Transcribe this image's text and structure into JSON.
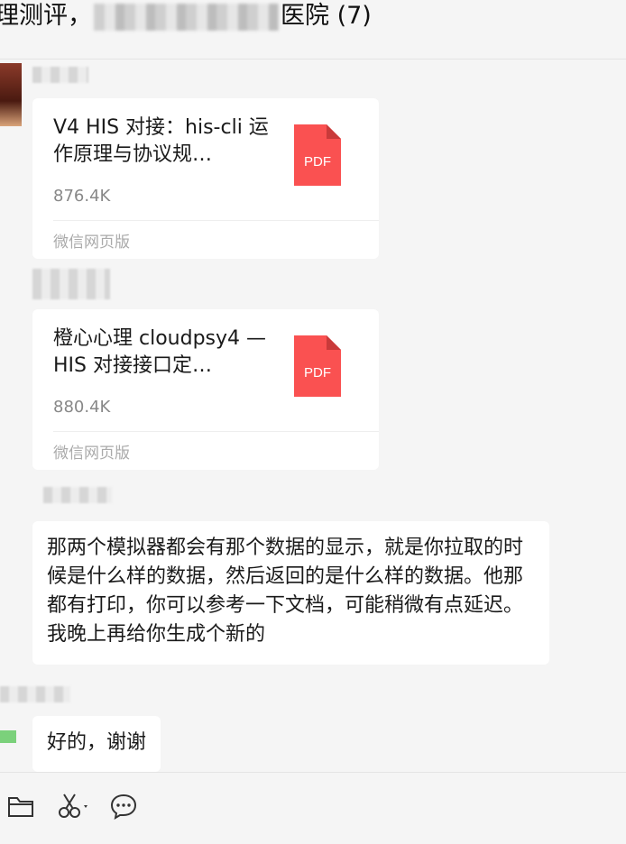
{
  "header": {
    "title_prefix": "理测评，",
    "title_suffix": "医院 (7)"
  },
  "messages": [
    {
      "type": "file",
      "file_name": "V4 HIS 对接：his-cli 运作原理与协议规…",
      "file_size": "876.4K",
      "source": "微信网页版",
      "icon_label": "PDF"
    },
    {
      "type": "file",
      "file_name": "橙心心理 cloudpsy4 — HIS 对接接口定…",
      "file_size": "880.4K",
      "source": "微信网页版",
      "icon_label": "PDF"
    },
    {
      "type": "text",
      "text": "那两个模拟器都会有那个数据的显示，就是你拉取的时候是什么样的数据，然后返回的是什么样的数据。他那都有打印，你可以参考一下文档，可能稍微有点延迟。我晚上再给你生成个新的"
    },
    {
      "type": "text",
      "text": "好的，谢谢"
    }
  ],
  "toolbar": {
    "items": [
      "folder-icon",
      "scissors-icon",
      "chat-bubble-icon"
    ]
  },
  "colors": {
    "pdf_red": "#fa5151",
    "bubble_bg": "#ffffff",
    "window_bg": "#f5f5f5"
  }
}
